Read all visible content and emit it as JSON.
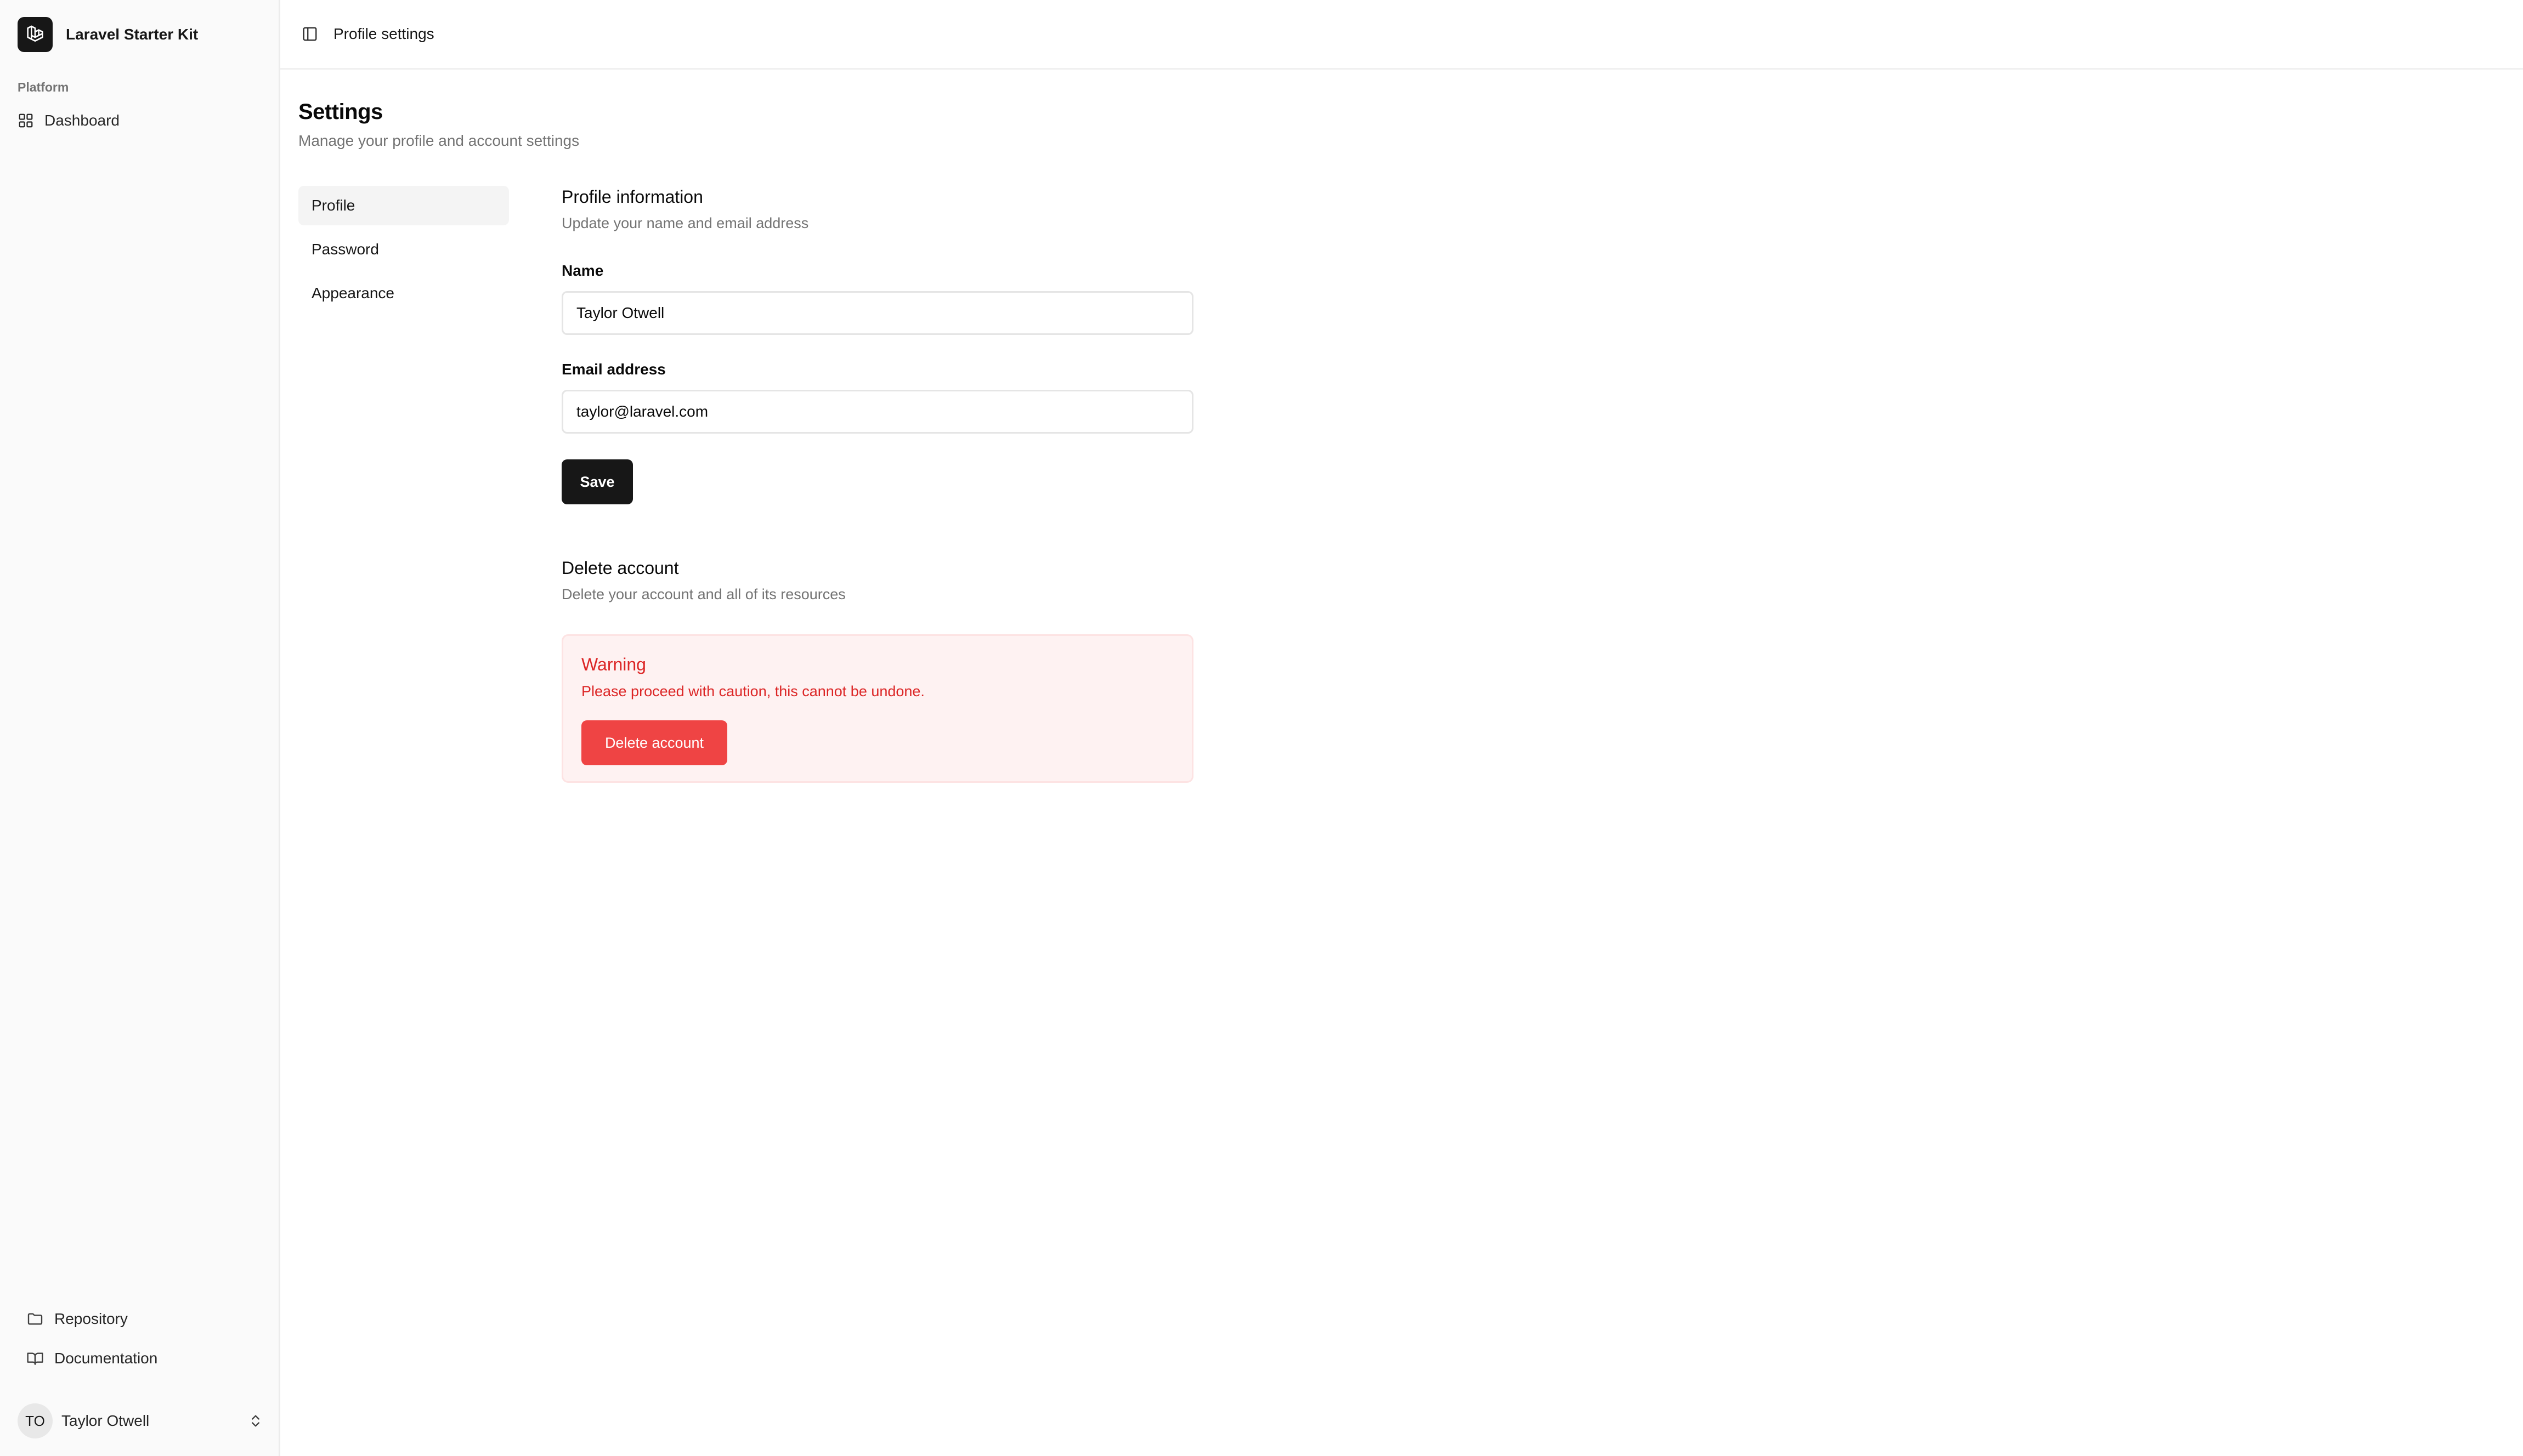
{
  "app": {
    "name": "Laravel Starter Kit",
    "logo_icon": "laravel-logo-icon"
  },
  "sidebar": {
    "group_label": "Platform",
    "items": [
      {
        "label": "Dashboard",
        "icon": "layout-grid-icon"
      }
    ],
    "footer_links": [
      {
        "label": "Repository",
        "icon": "folder-icon"
      },
      {
        "label": "Documentation",
        "icon": "book-open-icon"
      }
    ],
    "user": {
      "initials": "TO",
      "name": "Taylor Otwell",
      "menu_icon": "chevrons-up-down-icon"
    }
  },
  "header": {
    "toggle_icon": "panel-left-icon",
    "breadcrumb": "Profile settings"
  },
  "settings": {
    "title": "Settings",
    "subtitle": "Manage your profile and account settings",
    "nav": [
      {
        "label": "Profile",
        "active": true
      },
      {
        "label": "Password",
        "active": false
      },
      {
        "label": "Appearance",
        "active": false
      }
    ]
  },
  "profile": {
    "title": "Profile information",
    "description": "Update your name and email address",
    "name_label": "Name",
    "name_value": "Taylor Otwell",
    "email_label": "Email address",
    "email_value": "taylor@laravel.com",
    "save_label": "Save"
  },
  "delete_account": {
    "title": "Delete account",
    "description": "Delete your account and all of its resources",
    "warning_title": "Warning",
    "warning_text": "Please proceed with caution, this cannot be undone.",
    "button_label": "Delete account"
  },
  "colors": {
    "primary": "#171717",
    "danger": "#ef4444",
    "danger_text": "#dc2626",
    "danger_bg": "#fef2f2"
  }
}
